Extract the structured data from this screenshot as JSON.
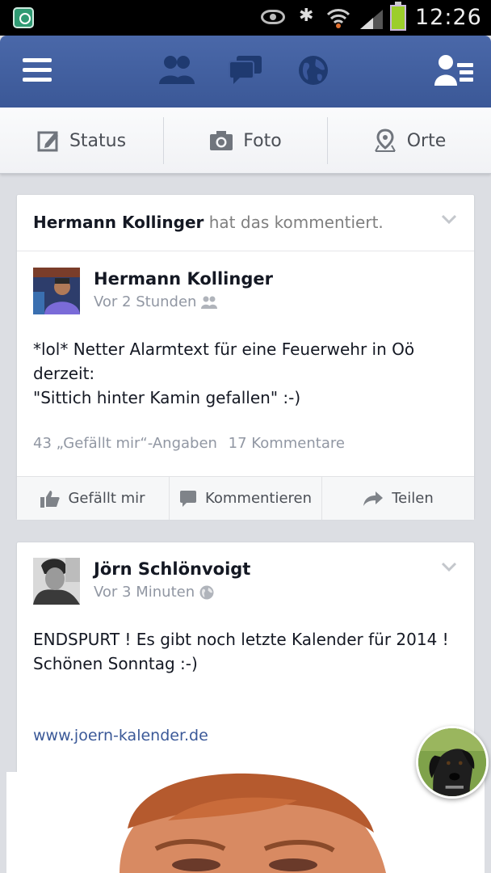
{
  "status_bar": {
    "time": "12:26"
  },
  "composer": {
    "status_label": "Status",
    "photo_label": "Foto",
    "places_label": "Orte"
  },
  "posts": [
    {
      "context_actor": "Hermann Kollinger",
      "context_action": "hat das kommentiert.",
      "author": "Hermann Kollinger",
      "timestamp": "Vor 2 Stunden",
      "audience_icon": "friends-icon",
      "text": "*lol* Netter Alarmtext für eine Feuerwehr in Oö derzeit:\n\"Sittich hinter Kamin gefallen\" :-)",
      "likes": "43 „Gefällt mir“-Angaben",
      "comments": "17 Kommentare",
      "actions": {
        "like": "Gefällt mir",
        "comment": "Kommentieren",
        "share": "Teilen"
      }
    },
    {
      "author": "Jörn Schlönvoigt",
      "timestamp": "Vor 3 Minuten",
      "audience_icon": "globe-icon",
      "text": "ENDSPURT ! Es gibt noch letzte Kalender für 2014 !\nSchönen Sonntag :-)",
      "link": "www.joern-kalender.de"
    }
  ],
  "colors": {
    "nav_blue": "#3b5998",
    "link_blue": "#3b5998",
    "meta_gray": "#9197a3"
  }
}
